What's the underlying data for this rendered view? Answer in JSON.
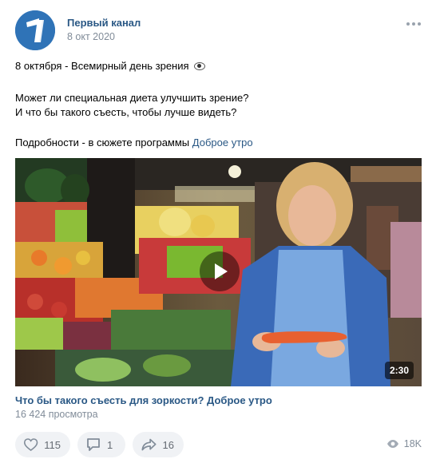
{
  "post": {
    "author": "Первый канал",
    "date": "8 окт 2020",
    "more_icon": "more-horizontal-icon",
    "text": {
      "line1": "8 октября - Всемирный день зрения",
      "line1_emoji": "eye-emoji",
      "line2": "Может ли специальная диета улучшить зрение?",
      "line3": "И что бы такого съесть, чтобы лучше видеть?",
      "line4_prefix": "Подробности - в сюжете программы ",
      "line4_link": "Доброе утро"
    },
    "video": {
      "duration": "2:30",
      "title": "Что бы такого съесть для зоркости? Доброе утро",
      "views": "16 424 просмотра"
    },
    "actions": {
      "likes": "115",
      "comments": "1",
      "shares": "16",
      "views": "18K"
    },
    "colors": {
      "link": "#2a5885",
      "secondary": "#818c99",
      "button_bg": "#f0f2f5",
      "brand": "#2f73b7"
    }
  }
}
